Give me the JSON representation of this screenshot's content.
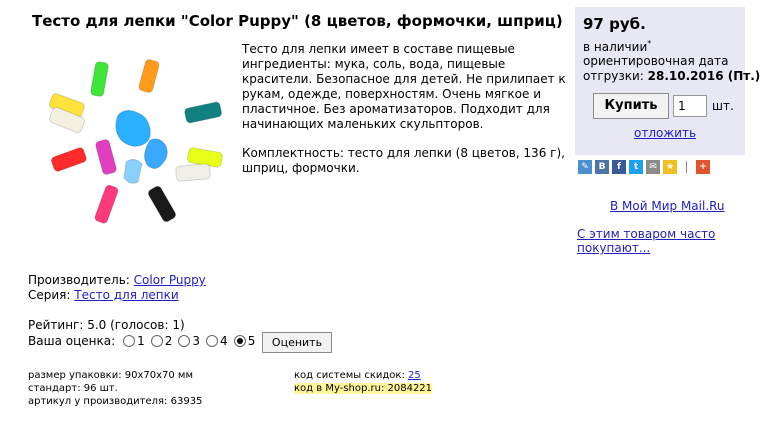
{
  "product": {
    "title": "Тесто для лепки \"Color Puppy\" (8 цветов, формочки, шприц)",
    "description": "Тесто для лепки имеет в составе пищевые ингредиенты: мука, соль, вода, пищевые красители. Безопасное для детей. Не прилипает к рукам, одежде, поверхностям. Очень мягкое и пластичное. Без ароматизаторов. Подходит для начинающих маленьких скульпторов.",
    "set": "Комплектность: тесто для лепки (8 цветов, 136 г), шприц, формочки."
  },
  "purchase": {
    "price": "97 руб.",
    "availability": "в наличии",
    "availability_mark": "*",
    "ship_label": "ориентировочная дата",
    "ship_prefix": "отгрузки:",
    "ship_date": "28.10.2016 (Пт.)",
    "buy_label": "Купить",
    "quantity": "1",
    "unit": "шт.",
    "later_label": "отложить"
  },
  "social": {
    "icons": [
      "livejournal-icon",
      "vk-icon",
      "facebook-icon",
      "twitter-icon",
      "email-icon",
      "bookmark-star-icon",
      "plus-icon"
    ],
    "colors": [
      "#4a8fcf",
      "#4c75a3",
      "#3b5998",
      "#1da1f2",
      "#8a8a8a",
      "#f0c020",
      "#e0552e"
    ]
  },
  "mailru_link": "В Мой Мир Mail.Ru",
  "also_bought": "С этим товаром часто покупают...",
  "info": {
    "manufacturer_label": "Производитель:",
    "manufacturer": "Color Puppy",
    "series_label": "Серия:",
    "series": "Тесто для лепки"
  },
  "rating": {
    "text": "Рейтинг: 5.0 (голосов: 1)",
    "vote_label": "Ваша оценка:",
    "options": [
      "1",
      "2",
      "3",
      "4",
      "5"
    ],
    "selected": "5",
    "submit_label": "Оценить"
  },
  "details": {
    "pack_size": "размер упаковки: 90x70x70 мм",
    "standard": "стандарт: 96 шт.",
    "article": "артикул у производителя: 63935",
    "discount_label": "код системы скидок:",
    "discount_code": "25",
    "shop_code": "код в My-shop.ru: 2084221"
  }
}
